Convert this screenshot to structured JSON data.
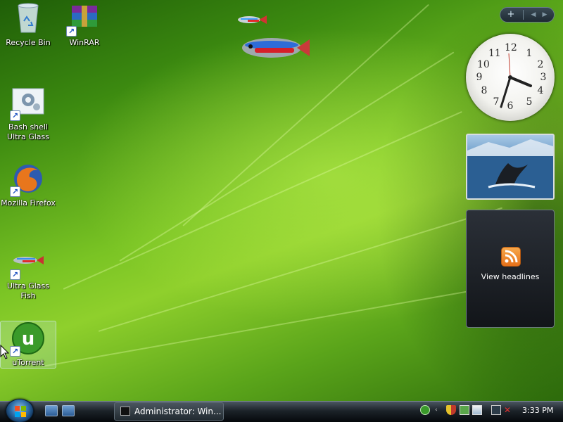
{
  "desktop_icons": [
    {
      "label": "Recycle Bin",
      "icon": "recycle-bin-icon"
    },
    {
      "label": "WinRAR",
      "icon": "winrar-icon"
    },
    {
      "label": "Bash shell Ultra Glass",
      "icon": "gear-shortcut-icon"
    },
    {
      "label": "Mozilla Firefox",
      "icon": "firefox-icon"
    },
    {
      "label": "Ultra Glass Fish",
      "icon": "fish-icon"
    },
    {
      "label": "uTorrent",
      "icon": "utorrent-icon"
    }
  ],
  "sidebar": {
    "add_label": "+",
    "prev_label": "◀",
    "next_label": "▶",
    "clock": {
      "hour_numbers": [
        "12",
        "1",
        "2",
        "3",
        "4",
        "5",
        "6",
        "7",
        "8",
        "9",
        "10",
        "11"
      ],
      "time": "3:33"
    },
    "feed_label": "View headlines"
  },
  "taskbar": {
    "task_button_label": "Administrator:  Win...",
    "clock_text": "3:33 PM"
  },
  "colors": {
    "desktop_green": "#7ac424",
    "feed_orange": "#e5701a",
    "utorrent_green": "#3a9a2a"
  }
}
